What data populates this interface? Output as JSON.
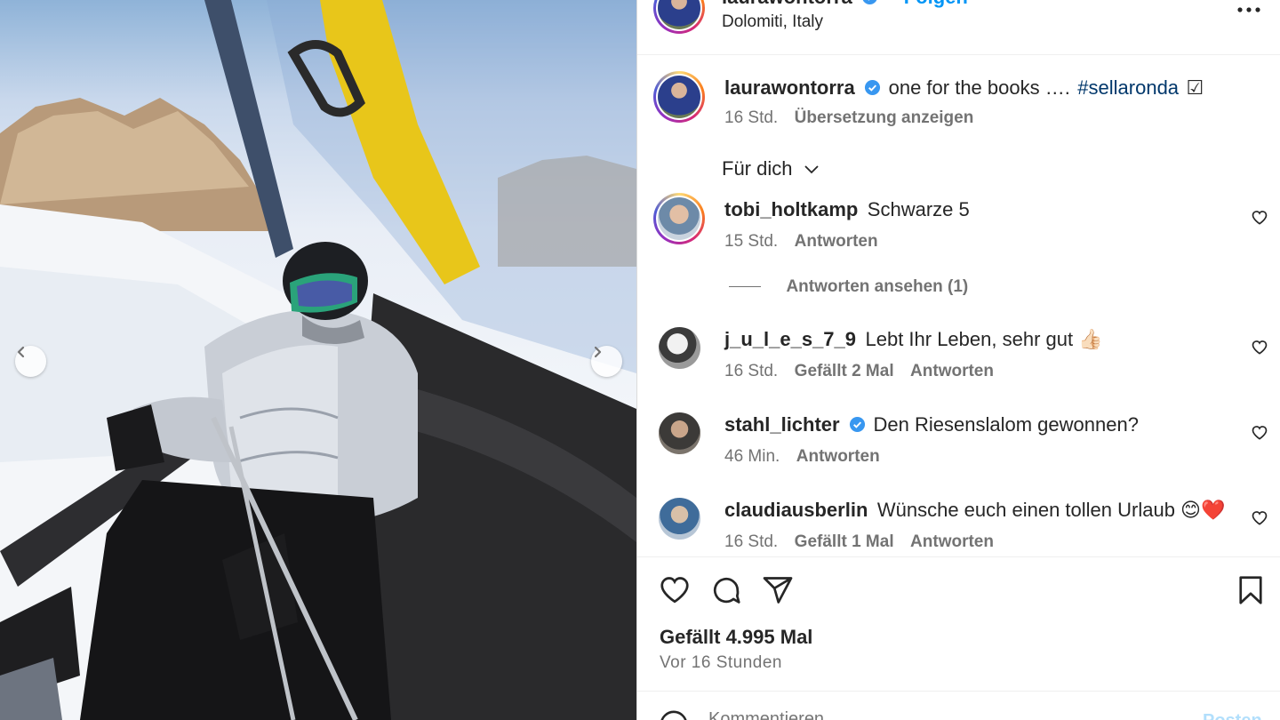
{
  "post": {
    "author": "laurawontorra",
    "follow_label": "Folgen",
    "location": "Dolomiti, Italy",
    "more_icon": "more-icon",
    "caption": {
      "username": "laurawontorra",
      "text": "one for the books ….",
      "hashtag": "#sellaronda",
      "emoji": "☑",
      "time": "16 Std.",
      "translate_label": "Übersetzung anzeigen"
    },
    "sort_label": "Für dich"
  },
  "comments": [
    {
      "username": "tobi_holtkamp",
      "verified": false,
      "text": "Schwarze 5",
      "time": "15 Std.",
      "likes": "",
      "reply_label": "Antworten",
      "view_replies": "Antworten ansehen (1)"
    },
    {
      "username": "j_u_l_e_s_7_9",
      "verified": false,
      "text": "Lebt Ihr Leben, sehr gut 👍🏻",
      "time": "16 Std.",
      "likes": "Gefällt 2 Mal",
      "reply_label": "Antworten"
    },
    {
      "username": "stahl_lichter",
      "verified": true,
      "text": "Den Riesenslalom gewonnen?",
      "time": "46 Min.",
      "likes": "",
      "reply_label": "Antworten"
    },
    {
      "username": "claudiausberlin",
      "verified": false,
      "text": "Wünsche euch einen tollen Urlaub 😊❤️",
      "time": "16 Std.",
      "likes": "Gefällt 1 Mal",
      "reply_label": "Antworten"
    }
  ],
  "footer": {
    "likes_count": "Gefällt 4.995 Mal",
    "posted_ago": "Vor 16 Stunden",
    "comment_placeholder": "Kommentieren …",
    "post_label": "Posten"
  },
  "colors": {
    "accent": "#0095f6",
    "verified": "#3897f0",
    "secondary_text": "#737373"
  }
}
